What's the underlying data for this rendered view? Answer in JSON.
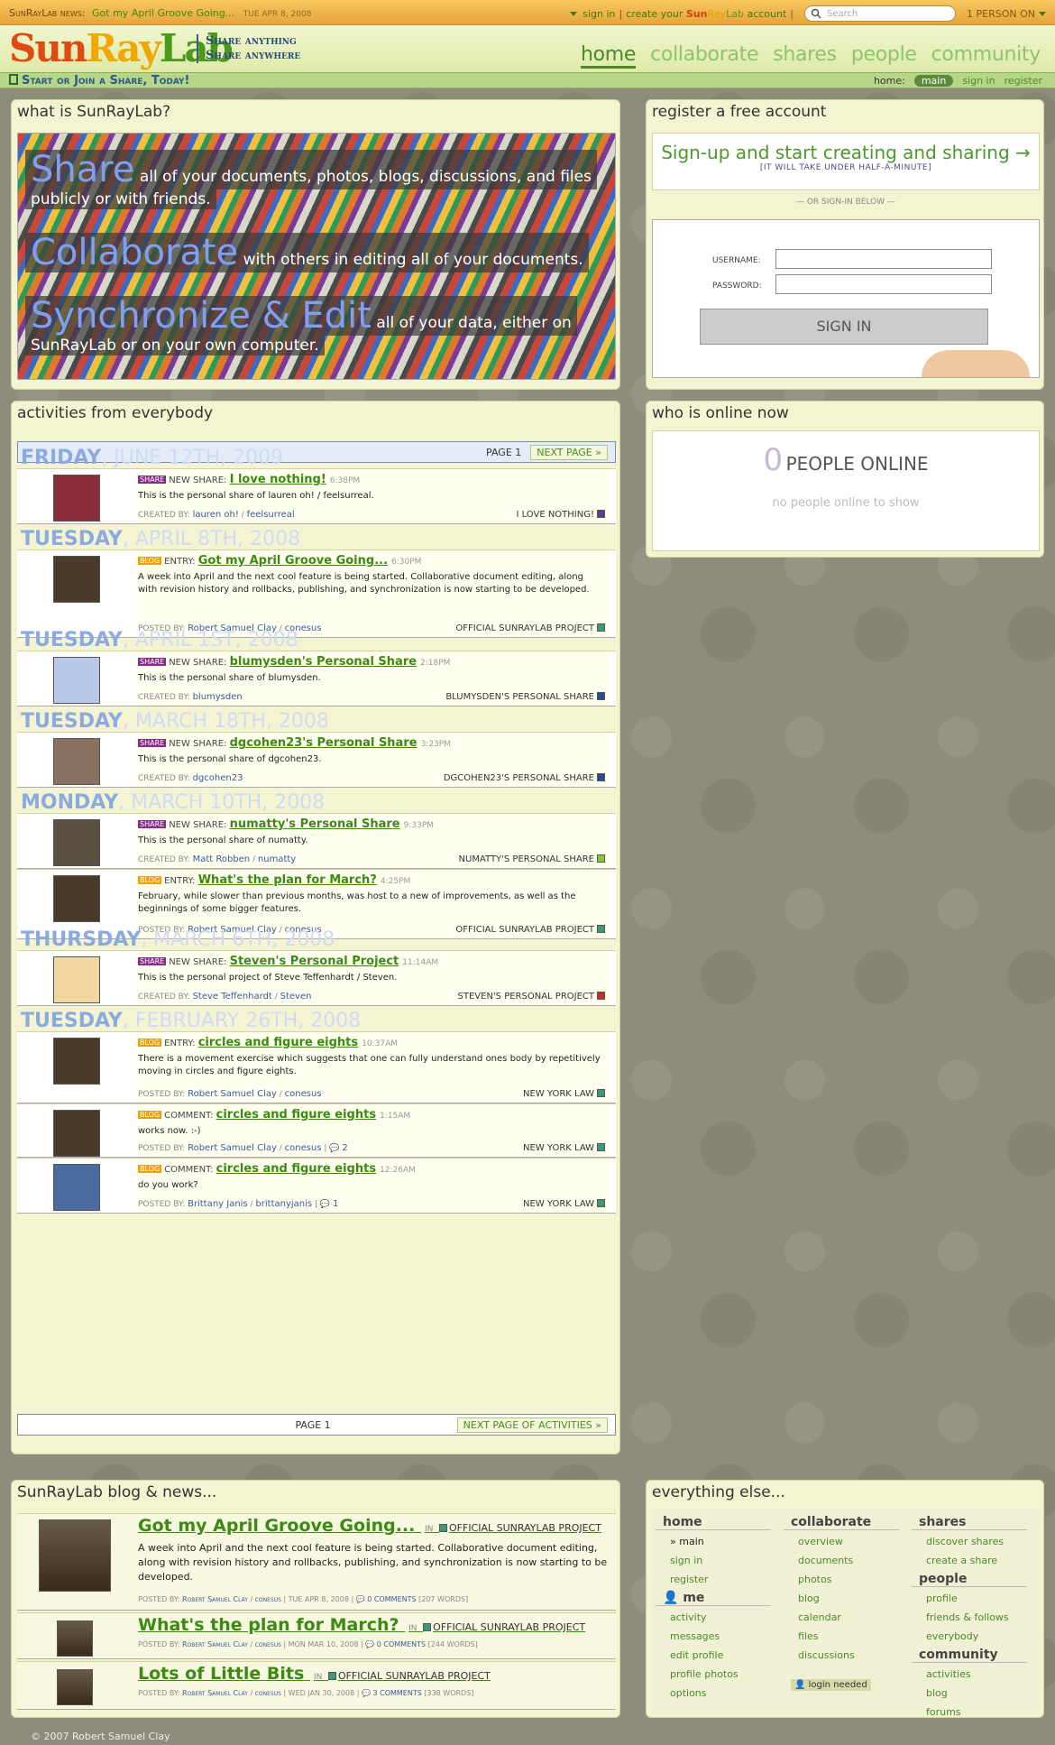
{
  "topbar": {
    "news_label": "SunRayLab news:",
    "news_title": "Got my April Groove Going...",
    "news_date": "TUE APR 8, 2008",
    "sign_in": "sign in",
    "separator": "|",
    "create_prefix": "create your",
    "create_brand_sun": "Sun",
    "create_brand_ray": "Ray",
    "create_brand_lab": "Lab",
    "create_suffix": "account",
    "search_placeholder": "Search",
    "people_on": "1 PERSON ON"
  },
  "header": {
    "logo_sun": "Sun",
    "logo_ray": "Ray",
    "logo_lab": "Lab",
    "tagline1": "Share anything",
    "tagline2": "Share anywhere",
    "nav": [
      "home",
      "collaborate",
      "shares",
      "people",
      "community"
    ]
  },
  "subbar": {
    "start": "Start or Join a Share, Today!",
    "home_label": "home:",
    "main": "main",
    "sign_in": "sign in",
    "register": "register"
  },
  "hero": {
    "title": "what is SunRayLab?",
    "line1_big": "Share",
    "line1_a": "all of your documents, photos, blogs, discussions, and files",
    "line1_b": "publicly or with friends.",
    "line2_big": "Collaborate",
    "line2_a": "with others in editing all of your documents.",
    "line3_big": "Synchronize & Edit",
    "line3_a": "all of your data, either on",
    "line3_b": "SunRayLab or on your own computer."
  },
  "register": {
    "title": "register a free account",
    "signup": "Sign-up and start creating and sharing →",
    "signup_sub": "[IT WILL TAKE UNDER HALF-A-MINUTE]",
    "or": "— OR SIGN-IN BELOW —",
    "username_label": "USERNAME:",
    "password_label": "PASSWORD:",
    "signin_button": "SIGN IN"
  },
  "activities": {
    "title": "activities from everybody",
    "page_label": "PAGE 1",
    "next_page": "NEXT PAGE",
    "next_page_bottom": "NEXT PAGE OF ACTIVITIES",
    "days": [
      {
        "day": "FRIDAY",
        "rest": ", JUNE 12TH, 2009"
      },
      {
        "day": "TUESDAY",
        "rest": ", APRIL 8TH, 2008"
      },
      {
        "day": "TUESDAY",
        "rest": ", APRIL 1ST, 2008"
      },
      {
        "day": "TUESDAY",
        "rest": ", MARCH 18TH, 2008"
      },
      {
        "day": "MONDAY",
        "rest": ", MARCH 10TH, 2008"
      },
      {
        "day": "THURSDAY",
        "rest": ", MARCH 6TH, 2008"
      },
      {
        "day": "TUESDAY",
        "rest": ", FEBRUARY 26TH, 2008"
      }
    ],
    "items": [
      {
        "badge": "SHARE",
        "kind": "NEW SHARE:",
        "title": "I love nothing!",
        "time": "6:38PM",
        "body": "This is the personal share of lauren oh! / feelsurreal.",
        "by_label": "CREATED BY:",
        "user": "lauren oh!",
        "handle": "feelsurreal",
        "comments": "",
        "share": "I LOVE NOTHING!",
        "color": "#5a3a9a"
      },
      {
        "badge": "BLOG",
        "kind": "ENTRY:",
        "title": "Got my April Groove Going...",
        "time": "6:30PM",
        "body": "A week into April and the next cool feature is being started. Collaborative document editing, along with revision history and rollbacks, publishing, and synchronization is now starting to be developed.",
        "by_label": "POSTED BY:",
        "user": "Robert Samuel Clay",
        "handle": "conesus",
        "comments": "",
        "share": "OFFICIAL SUNRAYLAB PROJECT",
        "color": "#3a9a7a"
      },
      {
        "badge": "SHARE",
        "kind": "NEW SHARE:",
        "title": "blumysden's Personal Share",
        "time": "2:18PM",
        "body": "This is the personal share of blumysden.",
        "by_label": "CREATED BY:",
        "user": "blumysden",
        "handle": "",
        "comments": "",
        "share": "BLUMYSDEN'S PERSONAL SHARE",
        "color": "#2a4a9a"
      },
      {
        "badge": "SHARE",
        "kind": "NEW SHARE:",
        "title": "dgcohen23's Personal Share",
        "time": "3:23PM",
        "body": "This is the personal share of dgcohen23.",
        "by_label": "CREATED BY:",
        "user": "dgcohen23",
        "handle": "",
        "comments": "",
        "share": "DGCOHEN23'S PERSONAL SHARE",
        "color": "#2a4a9a"
      },
      {
        "badge": "SHARE",
        "kind": "NEW SHARE:",
        "title": "numatty's Personal Share",
        "time": "9:33PM",
        "body": "This is the personal share of numatty.",
        "by_label": "CREATED BY:",
        "user": "Matt Robben",
        "handle": "numatty",
        "comments": "",
        "share": "NUMATTY'S PERSONAL SHARE",
        "color": "#8ac83a"
      },
      {
        "badge": "BLOG",
        "kind": "ENTRY:",
        "title": "What's the plan for March?",
        "time": "4:25PM",
        "body": "February, while slower than previous months, was host to a new of improvements, as well as the beginnings of some bigger features.",
        "by_label": "POSTED BY:",
        "user": "Robert Samuel Clay",
        "handle": "conesus",
        "comments": "",
        "share": "OFFICIAL SUNRAYLAB PROJECT",
        "color": "#3a9a7a"
      },
      {
        "badge": "SHARE",
        "kind": "NEW SHARE:",
        "title": "Steven's Personal Project",
        "time": "11:14AM",
        "body": "This is the personal project of Steve Teffenhardt / Steven.",
        "by_label": "CREATED BY:",
        "user": "Steve Teffenhardt",
        "handle": "Steven",
        "comments": "",
        "share": "STEVEN'S PERSONAL PROJECT",
        "color": "#c82a2a"
      },
      {
        "badge": "BLOG",
        "kind": "ENTRY:",
        "title": "circles and figure eights",
        "time": "10:37AM",
        "body": "There is a movement exercise which suggests that one can fully understand ones body by repetitively moving in circles and figure eights.",
        "by_label": "POSTED BY:",
        "user": "Robert Samuel Clay",
        "handle": "conesus",
        "comments": "",
        "share": "NEW YORK LAW",
        "color": "#3a9a7a"
      },
      {
        "badge": "BLOG",
        "kind": "COMMENT:",
        "title": "circles and figure eights",
        "time": "1:15AM",
        "body": "works now. :-)",
        "by_label": "POSTED BY:",
        "user": "Robert Samuel Clay",
        "handle": "conesus",
        "comments": "2",
        "share": "NEW YORK LAW",
        "color": "#3a9a7a"
      },
      {
        "badge": "BLOG",
        "kind": "COMMENT:",
        "title": "circles and figure eights",
        "time": "12:26AM",
        "body": "do you work?",
        "by_label": "POSTED BY:",
        "user": "Brittany Janis",
        "handle": "brittanyjanis",
        "comments": "1",
        "share": "NEW YORK LAW",
        "color": "#3a9a7a"
      }
    ]
  },
  "who": {
    "title": "who is online now",
    "count": "0",
    "label": "PEOPLE ONLINE",
    "none": "no people online to show"
  },
  "blog": {
    "title": "SunRayLab blog & news...",
    "in": "IN",
    "project": "OFFICIAL SUNRAYLAB PROJECT",
    "posted_by": "POSTED BY:",
    "posts": [
      {
        "title": "Got my April Groove Going...",
        "body": "A week into April and the next cool feature is being started. Collaborative document editing, along with revision history and rollbacks, publishing, and synchronization is now starting to be developed.",
        "user": "Robert Samuel Clay",
        "handle": "conesus",
        "date": "TUE APR 8, 2008",
        "comments": "0 COMMENTS",
        "words": "[207 WORDS]"
      },
      {
        "title": "What's the plan for March?",
        "body": "",
        "user": "Robert Samuel Clay",
        "handle": "conesus",
        "date": "MON MAR 10, 2008",
        "comments": "0 COMMENTS",
        "words": "[244 WORDS]"
      },
      {
        "title": "Lots of Little Bits",
        "body": "",
        "user": "Robert Samuel Clay",
        "handle": "conesus",
        "date": "WED JAN 30, 2008",
        "comments": "3 COMMENTS",
        "words": "[338 WORDS]"
      }
    ]
  },
  "else": {
    "title": "everything else...",
    "home": {
      "h": "home",
      "items": [
        "main",
        "sign in",
        "register"
      ]
    },
    "me": {
      "h": "me",
      "items": [
        "activity",
        "messages",
        "edit profile",
        "profile photos",
        "options"
      ]
    },
    "collaborate": {
      "h": "collaborate",
      "items": [
        "overview",
        "documents",
        "photos",
        "blog",
        "calendar",
        "files",
        "discussions"
      ]
    },
    "login_needed": "login needed",
    "shares": {
      "h": "shares",
      "items": [
        "discover shares",
        "create a share"
      ]
    },
    "people": {
      "h": "people",
      "items": [
        "profile",
        "friends & follows",
        "everybody"
      ]
    },
    "community": {
      "h": "community",
      "items": [
        "activities",
        "blog",
        "forums"
      ]
    }
  },
  "footer": {
    "copyright": "© 2007 Robert Samuel Clay"
  },
  "colors": {
    "accent_green": "#4a8a28",
    "orange_bar": "#e8a33a",
    "share_badge": "#8a2a8a",
    "blog_badge": "#f0a000"
  }
}
